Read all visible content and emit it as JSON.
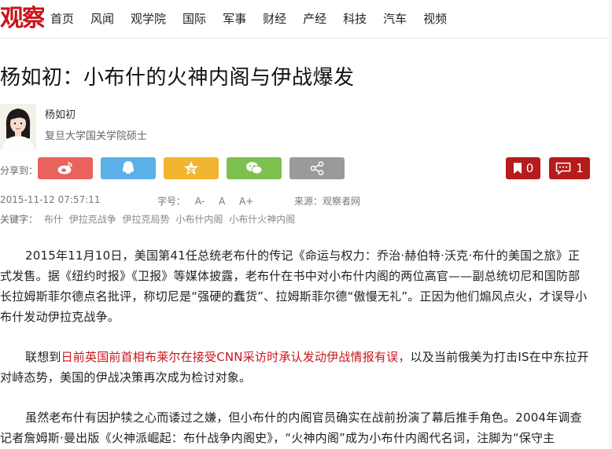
{
  "site": {
    "logo_text": "观察"
  },
  "nav": [
    "首页",
    "风闻",
    "观学院",
    "国际",
    "军事",
    "财经",
    "产经",
    "科技",
    "汽车",
    "视频"
  ],
  "article": {
    "title": "杨如初：小布什的火神内阁与伊战爆发",
    "author": {
      "name": "杨如初",
      "title": "复旦大学国关学院硕士"
    },
    "share_label": "分享到：",
    "share_buttons": [
      {
        "name": "weibo-icon",
        "color": "#e8625e"
      },
      {
        "name": "qq-icon",
        "color": "#5cb0e8"
      },
      {
        "name": "qzone-icon",
        "color": "#f2b530"
      },
      {
        "name": "wechat-icon",
        "color": "#7dc050"
      },
      {
        "name": "share-more-icon",
        "color": "#9a9a9a"
      }
    ],
    "bookmark_count": "0",
    "comment_count": "1",
    "datetime": "2015-11-12 07:57:11",
    "font_size": {
      "label": "字号：",
      "small": "A-",
      "normal": "A",
      "large": "A+"
    },
    "source": {
      "label": "来源：",
      "value": "观察者网"
    },
    "keywords_label": "关键字：",
    "keywords": [
      "布什",
      "伊拉克战争",
      "伊拉克局势",
      "小布什内阁",
      "小布什火神内阁"
    ],
    "paragraphs": [
      {
        "text": "2015年11月10日，美国第41任总统老布什的传记《命运与权力：乔治·赫伯特·沃克·布什的美国之旅》正式发售。据《纽约时报》《卫报》等媒体披露，老布什在书中对小布什内阁的两位高官——副总统切尼和国防部长拉姆斯菲尔德点名批评，称切尼是“强硬的蠢货”、拉姆斯菲尔德“傲慢无礼”。正因为他们煽风点火，才误导小布什发动伊拉克战争。"
      },
      {
        "before": "联想到",
        "link": "日前英国前首相布莱尔在接受CNN采访时承认发动伊战情报有误，",
        "after": "以及当前俄美为打击IS在中东拉开对峙态势，美国的伊战决策再次成为检讨对象。"
      },
      {
        "text": "虽然老布什有因护犊之心而诿过之嫌，但小布什的内阁官员确实在战前扮演了幕后推手角色。2004年调查记者詹姆斯·曼出版《火神派崛起：布什战争内阁史》，“火神内阁”成为小布什内阁代名词，注脚为“保守主"
      }
    ]
  }
}
